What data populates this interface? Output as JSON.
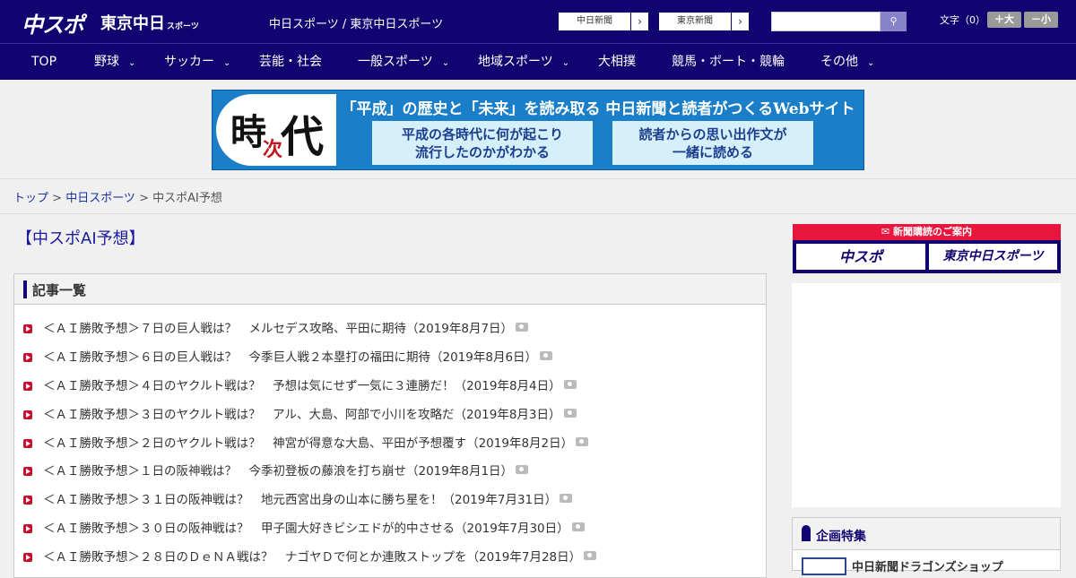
{
  "header": {
    "logo_main": "中スポ",
    "logo_sub": "東京中日",
    "logo_sub_small": "スポーツ",
    "site_title": "中日スポーツ / 東京中日スポーツ",
    "ext_links": [
      "中日新聞",
      "東京新聞"
    ],
    "search_placeholder": "",
    "font_size_label": "文字（0）",
    "font_plus": "＋大",
    "font_minus": "－小"
  },
  "nav": {
    "items": [
      {
        "label": "TOP",
        "dropdown": false
      },
      {
        "label": "野球",
        "dropdown": true
      },
      {
        "label": "サッカー",
        "dropdown": true
      },
      {
        "label": "芸能・社会",
        "dropdown": false
      },
      {
        "label": "一般スポーツ",
        "dropdown": true
      },
      {
        "label": "地域スポーツ",
        "dropdown": true
      },
      {
        "label": "大相撲",
        "dropdown": false
      },
      {
        "label": "競馬・ボート・競輪",
        "dropdown": false
      },
      {
        "label": "その他",
        "dropdown": true
      }
    ]
  },
  "banner": {
    "kanji": [
      "時",
      "次",
      "代"
    ],
    "headline": "「平成」の歴史と「未来」を読み取る 中日新聞と読者がつくるWebサイト",
    "box1": [
      "平成の各時代に何が起こり",
      "流行したのかがわかる"
    ],
    "box2": [
      "読者からの思い出作文が",
      "一緒に読める"
    ]
  },
  "breadcrumb": {
    "home": "トップ",
    "section": "中日スポーツ",
    "current": "中スポAI予想",
    "sep": " > "
  },
  "page": {
    "title": "【中スポAI予想】",
    "list_heading": "記事一覧",
    "articles": [
      "＜ＡＩ勝敗予想＞７日の巨人戦は？　メルセデス攻略、平田に期待（2019年8月7日）",
      "＜ＡＩ勝敗予想＞６日の巨人戦は？　今季巨人戦２本塁打の福田に期待（2019年8月6日）",
      "＜ＡＩ勝敗予想＞４日のヤクルト戦は？　予想は気にせず一気に３連勝だ！（2019年8月4日）",
      "＜ＡＩ勝敗予想＞３日のヤクルト戦は？　アル、大島、阿部で小川を攻略だ（2019年8月3日）",
      "＜ＡＩ勝敗予想＞２日のヤクルト戦は？　神宮が得意な大島、平田が予想覆す（2019年8月2日）",
      "＜ＡＩ勝敗予想＞１日の阪神戦は？　今季初登板の藤浪を打ち崩せ（2019年8月1日）",
      "＜ＡＩ勝敗予想＞３１日の阪神戦は？　地元西宮出身の山本に勝ち星を！（2019年7月31日）",
      "＜ＡＩ勝敗予想＞３０日の阪神戦は？　甲子園大好きビシエドが的中させる（2019年7月30日）",
      "＜ＡＩ勝敗予想＞２８日のＤｅＮＡ戦は？　ナゴヤＤで何とか連敗ストップを（2019年7月28日）"
    ]
  },
  "sidebar": {
    "subscribe_heading": "新聞購読のご案内",
    "sub_buttons": [
      "中スポ",
      "東京中日スポーツ"
    ],
    "feature_heading": "企画特集",
    "feature_item": "中日新聞ドラゴンズショップ"
  }
}
